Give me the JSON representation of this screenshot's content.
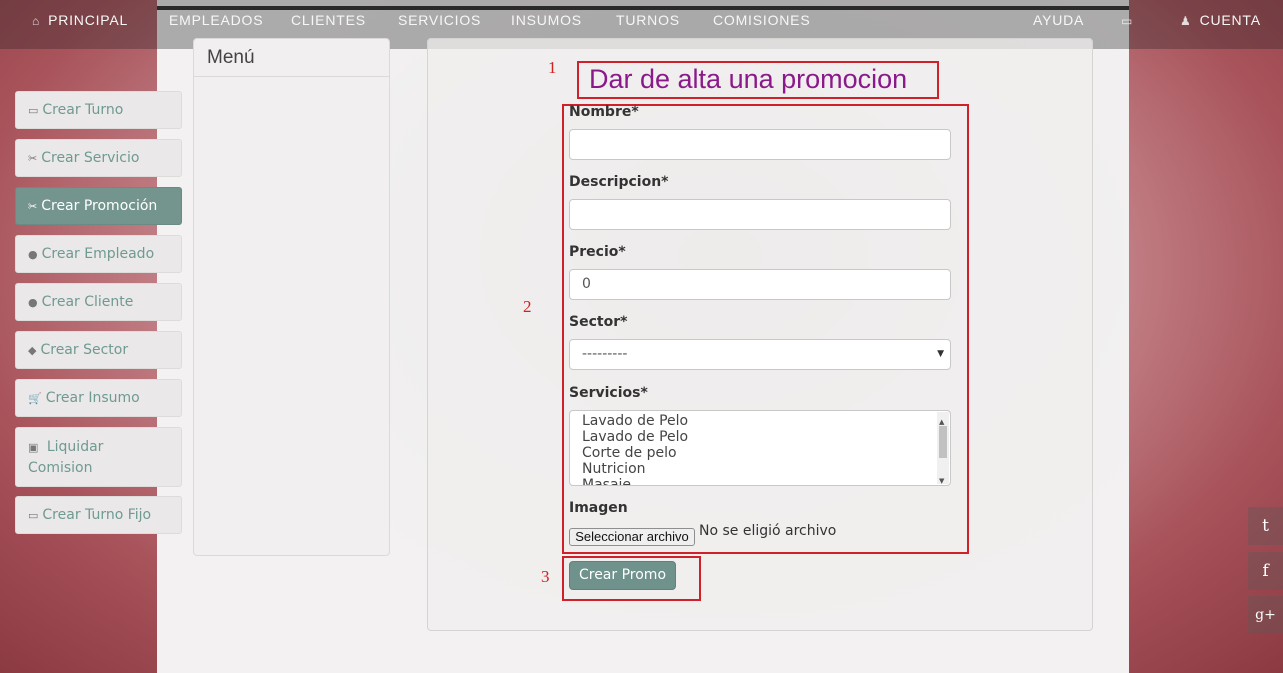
{
  "nav": {
    "left": [
      {
        "label": "PRINCIPAL",
        "icon": "home-icon"
      },
      {
        "label": "EMPLEADOS"
      },
      {
        "label": "CLIENTES"
      },
      {
        "label": "SERVICIOS"
      },
      {
        "label": "INSUMOS"
      },
      {
        "label": "TURNOS"
      },
      {
        "label": "COMISIONES"
      }
    ],
    "right": [
      {
        "label": "AYUDA"
      },
      {
        "label": "",
        "icon": "calendar-icon"
      },
      {
        "label": "CUENTA",
        "icon": "user-icon"
      }
    ]
  },
  "menu": {
    "title": "Menú",
    "items": [
      {
        "label": "Crear Turno",
        "icon": "calendar-icon",
        "glyph": "▭"
      },
      {
        "label": "Crear Servicio",
        "icon": "scissors-icon",
        "glyph": "✂"
      },
      {
        "label": "Crear Promoción",
        "icon": "scissors-icon",
        "glyph": "✂",
        "active": true
      },
      {
        "label": "Crear Empleado",
        "icon": "user-icon",
        "glyph": "●"
      },
      {
        "label": "Crear Cliente",
        "icon": "user-icon",
        "glyph": "●"
      },
      {
        "label": "Crear Sector",
        "icon": "tags-icon",
        "glyph": "◆"
      },
      {
        "label": "Crear Insumo",
        "icon": "cart-icon",
        "glyph": "🛒"
      },
      {
        "label": "Liquidar Comision",
        "icon": "money-icon",
        "glyph": "▣"
      },
      {
        "label": "Crear Turno Fijo",
        "icon": "calendar-icon",
        "glyph": "▭"
      }
    ]
  },
  "annotations": {
    "n1": "1",
    "n2": "2",
    "n3": "3"
  },
  "form": {
    "title": "Dar de alta una promocion",
    "nombre_label": "Nombre*",
    "nombre_value": "",
    "descripcion_label": "Descripcion*",
    "descripcion_value": "",
    "precio_label": "Precio*",
    "precio_value": "0",
    "sector_label": "Sector*",
    "sector_value": "---------",
    "servicios_label": "Servicios*",
    "servicios_options": [
      "Lavado de Pelo",
      "Lavado de Pelo",
      "Corte de pelo",
      "Nutricion",
      "Masaje"
    ],
    "imagen_label": "Imagen",
    "file_button": "Seleccionar archivo",
    "file_status": "No se eligió archivo",
    "submit": "Crear Promo"
  },
  "social": [
    {
      "icon": "twitter-icon",
      "glyph": "t"
    },
    {
      "icon": "facebook-icon",
      "glyph": "f"
    },
    {
      "icon": "google-plus-icon",
      "glyph": "g+"
    }
  ],
  "colors": {
    "accent": "#73958e",
    "annotation": "#d0202a",
    "title": "#8a1a8a"
  }
}
